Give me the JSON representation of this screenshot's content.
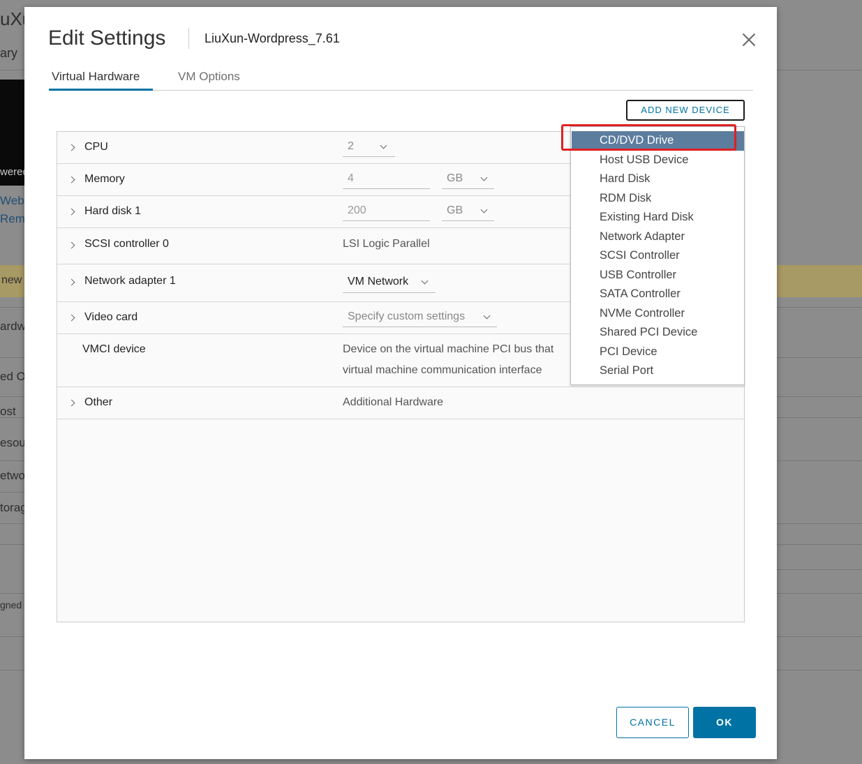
{
  "background": {
    "fragments": [
      "uXu",
      "ary",
      "wered",
      "Web",
      "Rem",
      "new",
      "ardw",
      "ed O",
      "ost",
      "esou",
      "etwo",
      "torag",
      "gned"
    ]
  },
  "dialog": {
    "title": "Edit Settings",
    "subtitle": "LiuXun-Wordpress_7.61",
    "tabs": [
      "Virtual Hardware",
      "VM Options"
    ],
    "add_device_label": "ADD NEW DEVICE",
    "cancel_label": "CANCEL",
    "ok_label": "OK"
  },
  "hardware": {
    "cpu": {
      "label": "CPU",
      "value": "2"
    },
    "memory": {
      "label": "Memory",
      "value": "4",
      "unit": "GB"
    },
    "hard_disk": {
      "label": "Hard disk 1",
      "value": "200",
      "unit": "GB"
    },
    "scsi": {
      "label": "SCSI controller 0",
      "value": "LSI Logic Parallel"
    },
    "network": {
      "label": "Network adapter 1",
      "value": "VM Network"
    },
    "video": {
      "label": "Video card",
      "value": "Specify custom settings"
    },
    "vmci": {
      "label": "VMCI device",
      "value_line1": "Device on the virtual machine PCI bus that",
      "value_line2": "virtual machine communication interface"
    },
    "other": {
      "label": "Other",
      "value": "Additional Hardware"
    }
  },
  "device_menu": {
    "items": [
      "CD/DVD Drive",
      "Host USB Device",
      "Hard Disk",
      "RDM Disk",
      "Existing Hard Disk",
      "Network Adapter",
      "SCSI Controller",
      "USB Controller",
      "SATA Controller",
      "NVMe Controller",
      "Shared PCI Device",
      "PCI Device",
      "Serial Port"
    ],
    "selected": "CD/DVD Drive"
  },
  "colors": {
    "accent": "#0072a3",
    "menu_selected": "#5c7d9e",
    "highlight": "#e02020"
  }
}
